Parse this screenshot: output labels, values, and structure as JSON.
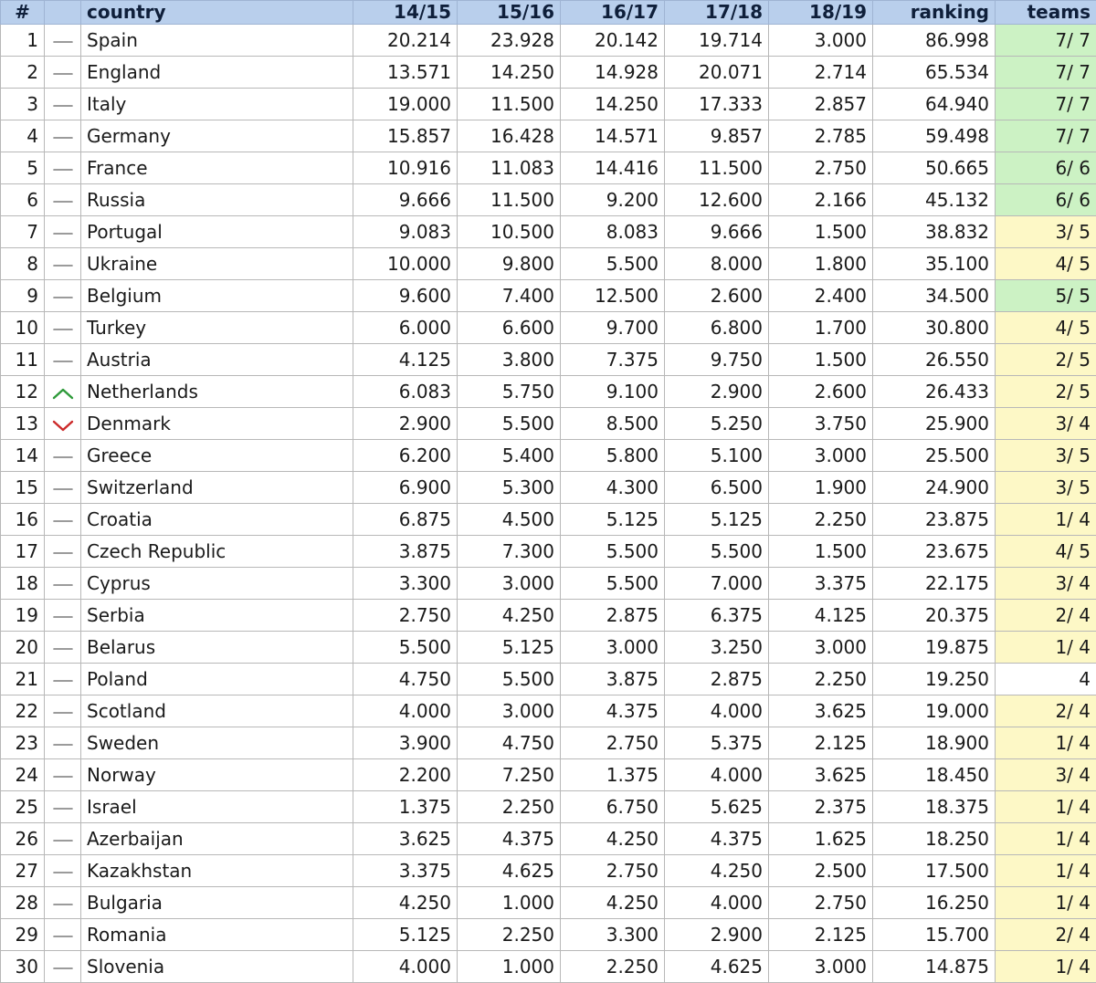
{
  "table": {
    "columns": [
      "#",
      "",
      "country",
      "14/15",
      "15/16",
      "16/17",
      "17/18",
      "18/19",
      "ranking",
      "teams"
    ],
    "rows": [
      {
        "rank": "1",
        "trend": "same",
        "country": "Spain",
        "s1415": "20.214",
        "s1516": "23.928",
        "s1617": "20.142",
        "s1718": "19.714",
        "s1819": "3.000",
        "ranking": "86.998",
        "teams": "7/ 7",
        "teams_status": "full"
      },
      {
        "rank": "2",
        "trend": "same",
        "country": "England",
        "s1415": "13.571",
        "s1516": "14.250",
        "s1617": "14.928",
        "s1718": "20.071",
        "s1819": "2.714",
        "ranking": "65.534",
        "teams": "7/ 7",
        "teams_status": "full"
      },
      {
        "rank": "3",
        "trend": "same",
        "country": "Italy",
        "s1415": "19.000",
        "s1516": "11.500",
        "s1617": "14.250",
        "s1718": "17.333",
        "s1819": "2.857",
        "ranking": "64.940",
        "teams": "7/ 7",
        "teams_status": "full"
      },
      {
        "rank": "4",
        "trend": "same",
        "country": "Germany",
        "s1415": "15.857",
        "s1516": "16.428",
        "s1617": "14.571",
        "s1718": "9.857",
        "s1819": "2.785",
        "ranking": "59.498",
        "teams": "7/ 7",
        "teams_status": "full"
      },
      {
        "rank": "5",
        "trend": "same",
        "country": "France",
        "s1415": "10.916",
        "s1516": "11.083",
        "s1617": "14.416",
        "s1718": "11.500",
        "s1819": "2.750",
        "ranking": "50.665",
        "teams": "6/ 6",
        "teams_status": "full"
      },
      {
        "rank": "6",
        "trend": "same",
        "country": "Russia",
        "s1415": "9.666",
        "s1516": "11.500",
        "s1617": "9.200",
        "s1718": "12.600",
        "s1819": "2.166",
        "ranking": "45.132",
        "teams": "6/ 6",
        "teams_status": "full"
      },
      {
        "rank": "7",
        "trend": "same",
        "country": "Portugal",
        "s1415": "9.083",
        "s1516": "10.500",
        "s1617": "8.083",
        "s1718": "9.666",
        "s1819": "1.500",
        "ranking": "38.832",
        "teams": "3/ 5",
        "teams_status": "partial"
      },
      {
        "rank": "8",
        "trend": "same",
        "country": "Ukraine",
        "s1415": "10.000",
        "s1516": "9.800",
        "s1617": "5.500",
        "s1718": "8.000",
        "s1819": "1.800",
        "ranking": "35.100",
        "teams": "4/ 5",
        "teams_status": "partial"
      },
      {
        "rank": "9",
        "trend": "same",
        "country": "Belgium",
        "s1415": "9.600",
        "s1516": "7.400",
        "s1617": "12.500",
        "s1718": "2.600",
        "s1819": "2.400",
        "ranking": "34.500",
        "teams": "5/ 5",
        "teams_status": "full"
      },
      {
        "rank": "10",
        "trend": "same",
        "country": "Turkey",
        "s1415": "6.000",
        "s1516": "6.600",
        "s1617": "9.700",
        "s1718": "6.800",
        "s1819": "1.700",
        "ranking": "30.800",
        "teams": "4/ 5",
        "teams_status": "partial"
      },
      {
        "rank": "11",
        "trend": "same",
        "country": "Austria",
        "s1415": "4.125",
        "s1516": "3.800",
        "s1617": "7.375",
        "s1718": "9.750",
        "s1819": "1.500",
        "ranking": "26.550",
        "teams": "2/ 5",
        "teams_status": "partial"
      },
      {
        "rank": "12",
        "trend": "up",
        "country": "Netherlands",
        "s1415": "6.083",
        "s1516": "5.750",
        "s1617": "9.100",
        "s1718": "2.900",
        "s1819": "2.600",
        "ranking": "26.433",
        "teams": "2/ 5",
        "teams_status": "partial"
      },
      {
        "rank": "13",
        "trend": "down",
        "country": "Denmark",
        "s1415": "2.900",
        "s1516": "5.500",
        "s1617": "8.500",
        "s1718": "5.250",
        "s1819": "3.750",
        "ranking": "25.900",
        "teams": "3/ 4",
        "teams_status": "partial"
      },
      {
        "rank": "14",
        "trend": "same",
        "country": "Greece",
        "s1415": "6.200",
        "s1516": "5.400",
        "s1617": "5.800",
        "s1718": "5.100",
        "s1819": "3.000",
        "ranking": "25.500",
        "teams": "3/ 5",
        "teams_status": "partial"
      },
      {
        "rank": "15",
        "trend": "same",
        "country": "Switzerland",
        "s1415": "6.900",
        "s1516": "5.300",
        "s1617": "4.300",
        "s1718": "6.500",
        "s1819": "1.900",
        "ranking": "24.900",
        "teams": "3/ 5",
        "teams_status": "partial"
      },
      {
        "rank": "16",
        "trend": "same",
        "country": "Croatia",
        "s1415": "6.875",
        "s1516": "4.500",
        "s1617": "5.125",
        "s1718": "5.125",
        "s1819": "2.250",
        "ranking": "23.875",
        "teams": "1/ 4",
        "teams_status": "partial"
      },
      {
        "rank": "17",
        "trend": "same",
        "country": "Czech Republic",
        "s1415": "3.875",
        "s1516": "7.300",
        "s1617": "5.500",
        "s1718": "5.500",
        "s1819": "1.500",
        "ranking": "23.675",
        "teams": "4/ 5",
        "teams_status": "partial"
      },
      {
        "rank": "18",
        "trend": "same",
        "country": "Cyprus",
        "s1415": "3.300",
        "s1516": "3.000",
        "s1617": "5.500",
        "s1718": "7.000",
        "s1819": "3.375",
        "ranking": "22.175",
        "teams": "3/ 4",
        "teams_status": "partial"
      },
      {
        "rank": "19",
        "trend": "same",
        "country": "Serbia",
        "s1415": "2.750",
        "s1516": "4.250",
        "s1617": "2.875",
        "s1718": "6.375",
        "s1819": "4.125",
        "ranking": "20.375",
        "teams": "2/ 4",
        "teams_status": "partial"
      },
      {
        "rank": "20",
        "trend": "same",
        "country": "Belarus",
        "s1415": "5.500",
        "s1516": "5.125",
        "s1617": "3.000",
        "s1718": "3.250",
        "s1819": "3.000",
        "ranking": "19.875",
        "teams": "1/ 4",
        "teams_status": "partial"
      },
      {
        "rank": "21",
        "trend": "same",
        "country": "Poland",
        "s1415": "4.750",
        "s1516": "5.500",
        "s1617": "3.875",
        "s1718": "2.875",
        "s1819": "2.250",
        "ranking": "19.250",
        "teams": "4",
        "teams_status": "none"
      },
      {
        "rank": "22",
        "trend": "same",
        "country": "Scotland",
        "s1415": "4.000",
        "s1516": "3.000",
        "s1617": "4.375",
        "s1718": "4.000",
        "s1819": "3.625",
        "ranking": "19.000",
        "teams": "2/ 4",
        "teams_status": "partial"
      },
      {
        "rank": "23",
        "trend": "same",
        "country": "Sweden",
        "s1415": "3.900",
        "s1516": "4.750",
        "s1617": "2.750",
        "s1718": "5.375",
        "s1819": "2.125",
        "ranking": "18.900",
        "teams": "1/ 4",
        "teams_status": "partial"
      },
      {
        "rank": "24",
        "trend": "same",
        "country": "Norway",
        "s1415": "2.200",
        "s1516": "7.250",
        "s1617": "1.375",
        "s1718": "4.000",
        "s1819": "3.625",
        "ranking": "18.450",
        "teams": "3/ 4",
        "teams_status": "partial"
      },
      {
        "rank": "25",
        "trend": "same",
        "country": "Israel",
        "s1415": "1.375",
        "s1516": "2.250",
        "s1617": "6.750",
        "s1718": "5.625",
        "s1819": "2.375",
        "ranking": "18.375",
        "teams": "1/ 4",
        "teams_status": "partial"
      },
      {
        "rank": "26",
        "trend": "same",
        "country": "Azerbaijan",
        "s1415": "3.625",
        "s1516": "4.375",
        "s1617": "4.250",
        "s1718": "4.375",
        "s1819": "1.625",
        "ranking": "18.250",
        "teams": "1/ 4",
        "teams_status": "partial"
      },
      {
        "rank": "27",
        "trend": "same",
        "country": "Kazakhstan",
        "s1415": "3.375",
        "s1516": "4.625",
        "s1617": "2.750",
        "s1718": "4.250",
        "s1819": "2.500",
        "ranking": "17.500",
        "teams": "1/ 4",
        "teams_status": "partial"
      },
      {
        "rank": "28",
        "trend": "same",
        "country": "Bulgaria",
        "s1415": "4.250",
        "s1516": "1.000",
        "s1617": "4.250",
        "s1718": "4.000",
        "s1819": "2.750",
        "ranking": "16.250",
        "teams": "1/ 4",
        "teams_status": "partial"
      },
      {
        "rank": "29",
        "trend": "same",
        "country": "Romania",
        "s1415": "5.125",
        "s1516": "2.250",
        "s1617": "3.300",
        "s1718": "2.900",
        "s1819": "2.125",
        "ranking": "15.700",
        "teams": "2/ 4",
        "teams_status": "partial"
      },
      {
        "rank": "30",
        "trend": "same",
        "country": "Slovenia",
        "s1415": "4.000",
        "s1516": "1.000",
        "s1617": "2.250",
        "s1718": "4.625",
        "s1819": "3.000",
        "ranking": "14.875",
        "teams": "1/ 4",
        "teams_status": "partial"
      }
    ]
  },
  "icons": {
    "same": "dash-icon",
    "up": "chevron-up-icon",
    "down": "chevron-down-icon"
  },
  "colors": {
    "header_bg": "#b9cfec",
    "teams_full": "#ccf2c4",
    "teams_partial": "#fdf8c6",
    "trend_up": "#2e9a3a",
    "trend_down": "#cc2a2a",
    "trend_same": "#7a7a7a"
  }
}
